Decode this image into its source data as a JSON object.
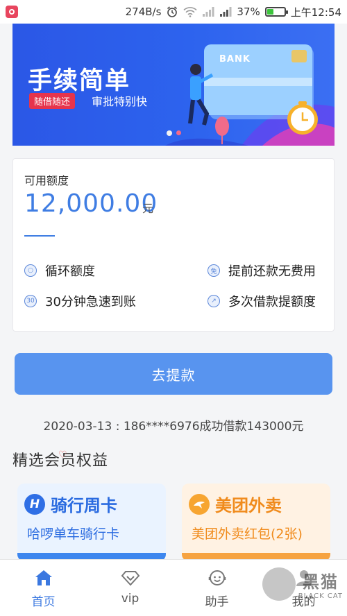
{
  "status_bar": {
    "speed": "274B/s",
    "battery": "37%",
    "battery_level": 0.37,
    "time": "上午12:54"
  },
  "banner": {
    "title": "手续简单",
    "tag": "随借随还",
    "subtitle": "审批特别快",
    "card_text": "BANK"
  },
  "credit": {
    "label": "可用额度",
    "amount": "12,000.00",
    "unit": "元",
    "features": [
      {
        "icon": "cycle-icon",
        "text": "循环额度"
      },
      {
        "icon": "free-icon",
        "text": "提前还款无费用"
      },
      {
        "icon": "clock-30-icon",
        "text": "30分钟急速到账"
      },
      {
        "icon": "growth-icon",
        "text": "多次借款提额度"
      }
    ]
  },
  "cta": {
    "label": "去提款"
  },
  "notice": "2020-03-13 : 186****6976成功借款143000元",
  "perks": {
    "title": "精选会员权益",
    "cards": [
      {
        "title": "骑行周卡",
        "subtitle": "哈啰单车骑行卡",
        "logo": "H"
      },
      {
        "title": "美团外卖",
        "subtitle": "美团外卖红包(2张)"
      }
    ]
  },
  "tabs": [
    {
      "label": "首页",
      "icon": "home-icon",
      "active": true
    },
    {
      "label": "vip",
      "icon": "vip-icon",
      "active": false
    },
    {
      "label": "助手",
      "icon": "assistant-icon",
      "active": false
    },
    {
      "label": "我的",
      "icon": "profile-icon",
      "active": false
    }
  ],
  "watermark": {
    "big": "黑猫",
    "small": "BLACK CAT"
  },
  "colors": {
    "accent": "#3f7de3",
    "button": "#5894ef",
    "banner": "#2b57e6"
  }
}
